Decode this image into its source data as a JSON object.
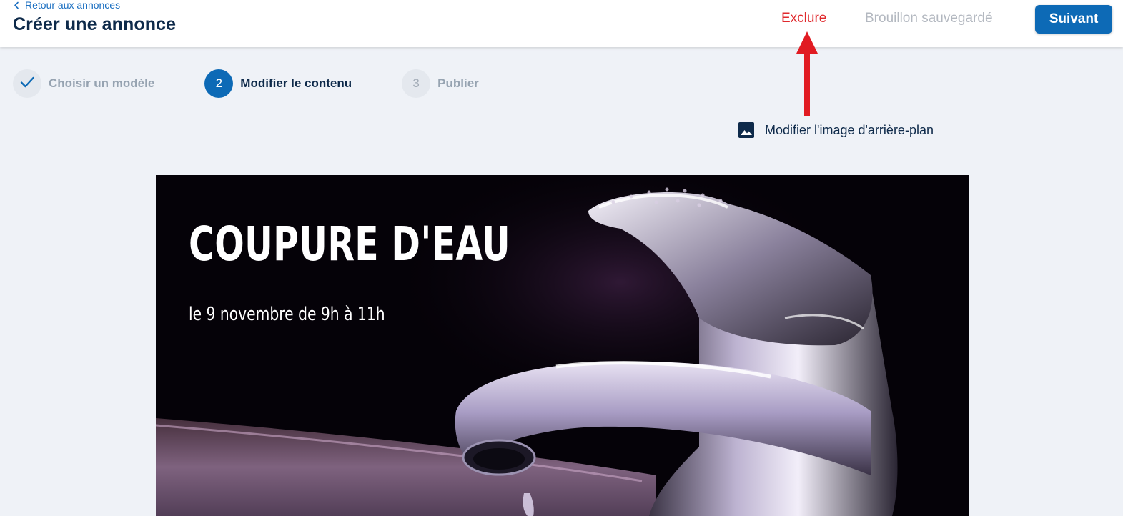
{
  "header": {
    "back_label": "Retour aux annonces",
    "title": "Créer une annonce",
    "exclude_label": "Exclure",
    "draft_status": "Brouillon sauvegardé",
    "next_label": "Suivant"
  },
  "stepper": {
    "steps": [
      {
        "label": "Choisir un modèle",
        "state": "completed"
      },
      {
        "number": "2",
        "label": "Modifier le contenu",
        "state": "active"
      },
      {
        "number": "3",
        "label": "Publier",
        "state": "upcoming"
      }
    ]
  },
  "editor": {
    "edit_background_label": "Modifier l'image d'arrière-plan"
  },
  "preview": {
    "title": "COUPURE D'EAU",
    "subtitle": "le 9 novembre de 9h à 11h"
  },
  "colors": {
    "primary": "#0d6ab6",
    "danger": "#e0292d",
    "heading": "#0e2a4a",
    "muted": "#b3b8c0",
    "page_background": "#eff2f7",
    "annotation_arrow": "#e11b22"
  },
  "icons": {
    "back": "chevron-left-icon",
    "completed_step": "check-icon",
    "edit_background": "image-icon",
    "annotation": "arrow-up-icon"
  }
}
